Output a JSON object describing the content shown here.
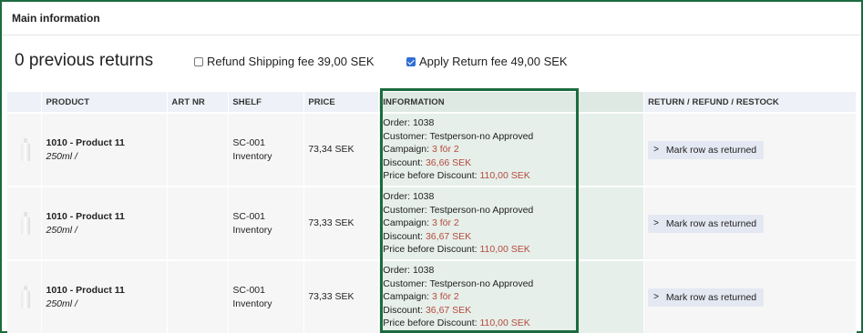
{
  "section": {
    "title": "Main information"
  },
  "returns_summary": "0 previous returns",
  "options": {
    "refund_shipping": {
      "label": "Refund Shipping fee 39,00 SEK",
      "checked": false
    },
    "apply_return_fee": {
      "label": "Apply Return fee 49,00 SEK",
      "checked": true
    }
  },
  "table": {
    "headers": [
      "",
      "PRODUCT",
      "ART NR",
      "SHELF",
      "PRICE",
      "INFORMATION",
      "RETURN / REFUND / RESTOCK"
    ],
    "rows": [
      {
        "product_name": "1010 - Product 11",
        "variant": "250ml /",
        "art_nr": "",
        "shelf_code": "SC-001",
        "shelf_location": "Inventory",
        "price": "73,34 SEK",
        "order": "Order: 1038",
        "customer": "Customer: Testperson-no Approved",
        "campaign_label": "Campaign: ",
        "campaign_value": "3 för 2",
        "discount_label": "Discount: ",
        "discount_value": "36,66 SEK",
        "price_before_label": "Price before Discount: ",
        "price_before_value": "110,00 SEK",
        "action_label": "Mark row as returned"
      },
      {
        "product_name": "1010 - Product 11",
        "variant": "250ml /",
        "art_nr": "",
        "shelf_code": "SC-001",
        "shelf_location": "Inventory",
        "price": "73,33 SEK",
        "order": "Order: 1038",
        "customer": "Customer: Testperson-no Approved",
        "campaign_label": "Campaign: ",
        "campaign_value": "3 för 2",
        "discount_label": "Discount: ",
        "discount_value": "36,67 SEK",
        "price_before_label": "Price before Discount: ",
        "price_before_value": "110,00 SEK",
        "action_label": "Mark row as returned"
      },
      {
        "product_name": "1010 - Product 11",
        "variant": "250ml /",
        "art_nr": "",
        "shelf_code": "SC-001",
        "shelf_location": "Inventory",
        "price": "73,33 SEK",
        "order": "Order: 1038",
        "customer": "Customer: Testperson-no Approved",
        "campaign_label": "Campaign: ",
        "campaign_value": "3 för 2",
        "discount_label": "Discount: ",
        "discount_value": "36,67 SEK",
        "price_before_label": "Price before Discount: ",
        "price_before_value": "110,00 SEK",
        "action_label": "Mark row as returned"
      }
    ]
  },
  "colors": {
    "highlight_border": "#1c6b3f",
    "accent_red": "#b64a3f",
    "header_bg": "#eef1f7"
  },
  "icons": {
    "product_thumbnail": "bottle-icon",
    "row_action": "chevron-right-icon"
  }
}
